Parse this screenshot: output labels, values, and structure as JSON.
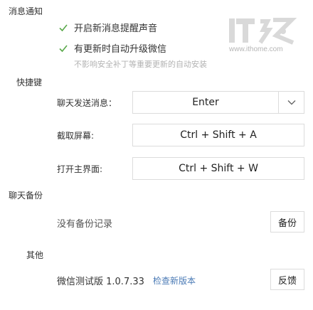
{
  "notifications": {
    "title": "消息通知",
    "options": [
      {
        "label": "开启新消息提醒声音",
        "checked": true
      },
      {
        "label": "有更新时自动升级微信",
        "checked": true
      }
    ],
    "hint": "不影响安全补丁等重要更新的自动安装"
  },
  "shortcuts": {
    "title": "快捷键",
    "send": {
      "label": "聊天发送消息：",
      "value": "Enter"
    },
    "screenshot": {
      "label": "截取屏幕:",
      "value": "Ctrl + Shift + A"
    },
    "open_main": {
      "label": "打开主界面:",
      "value": "Ctrl + Shift + W"
    }
  },
  "backup": {
    "title": "聊天备份",
    "status": "没有备份记录",
    "button": "备份"
  },
  "other": {
    "title": "其他",
    "version": "微信测试版 1.0.7.33",
    "check_update": "检查新版本",
    "feedback_button": "反馈"
  },
  "watermark": {
    "brand": "IT之家",
    "url": "www.ithome.com"
  },
  "colors": {
    "check": "#5aa94b",
    "link": "#4a7ab5",
    "hint": "#b3b3b3",
    "border": "#dcdcdc"
  },
  "icons": {
    "checkbox": "check-mark",
    "dropdown": "chevron-down"
  }
}
